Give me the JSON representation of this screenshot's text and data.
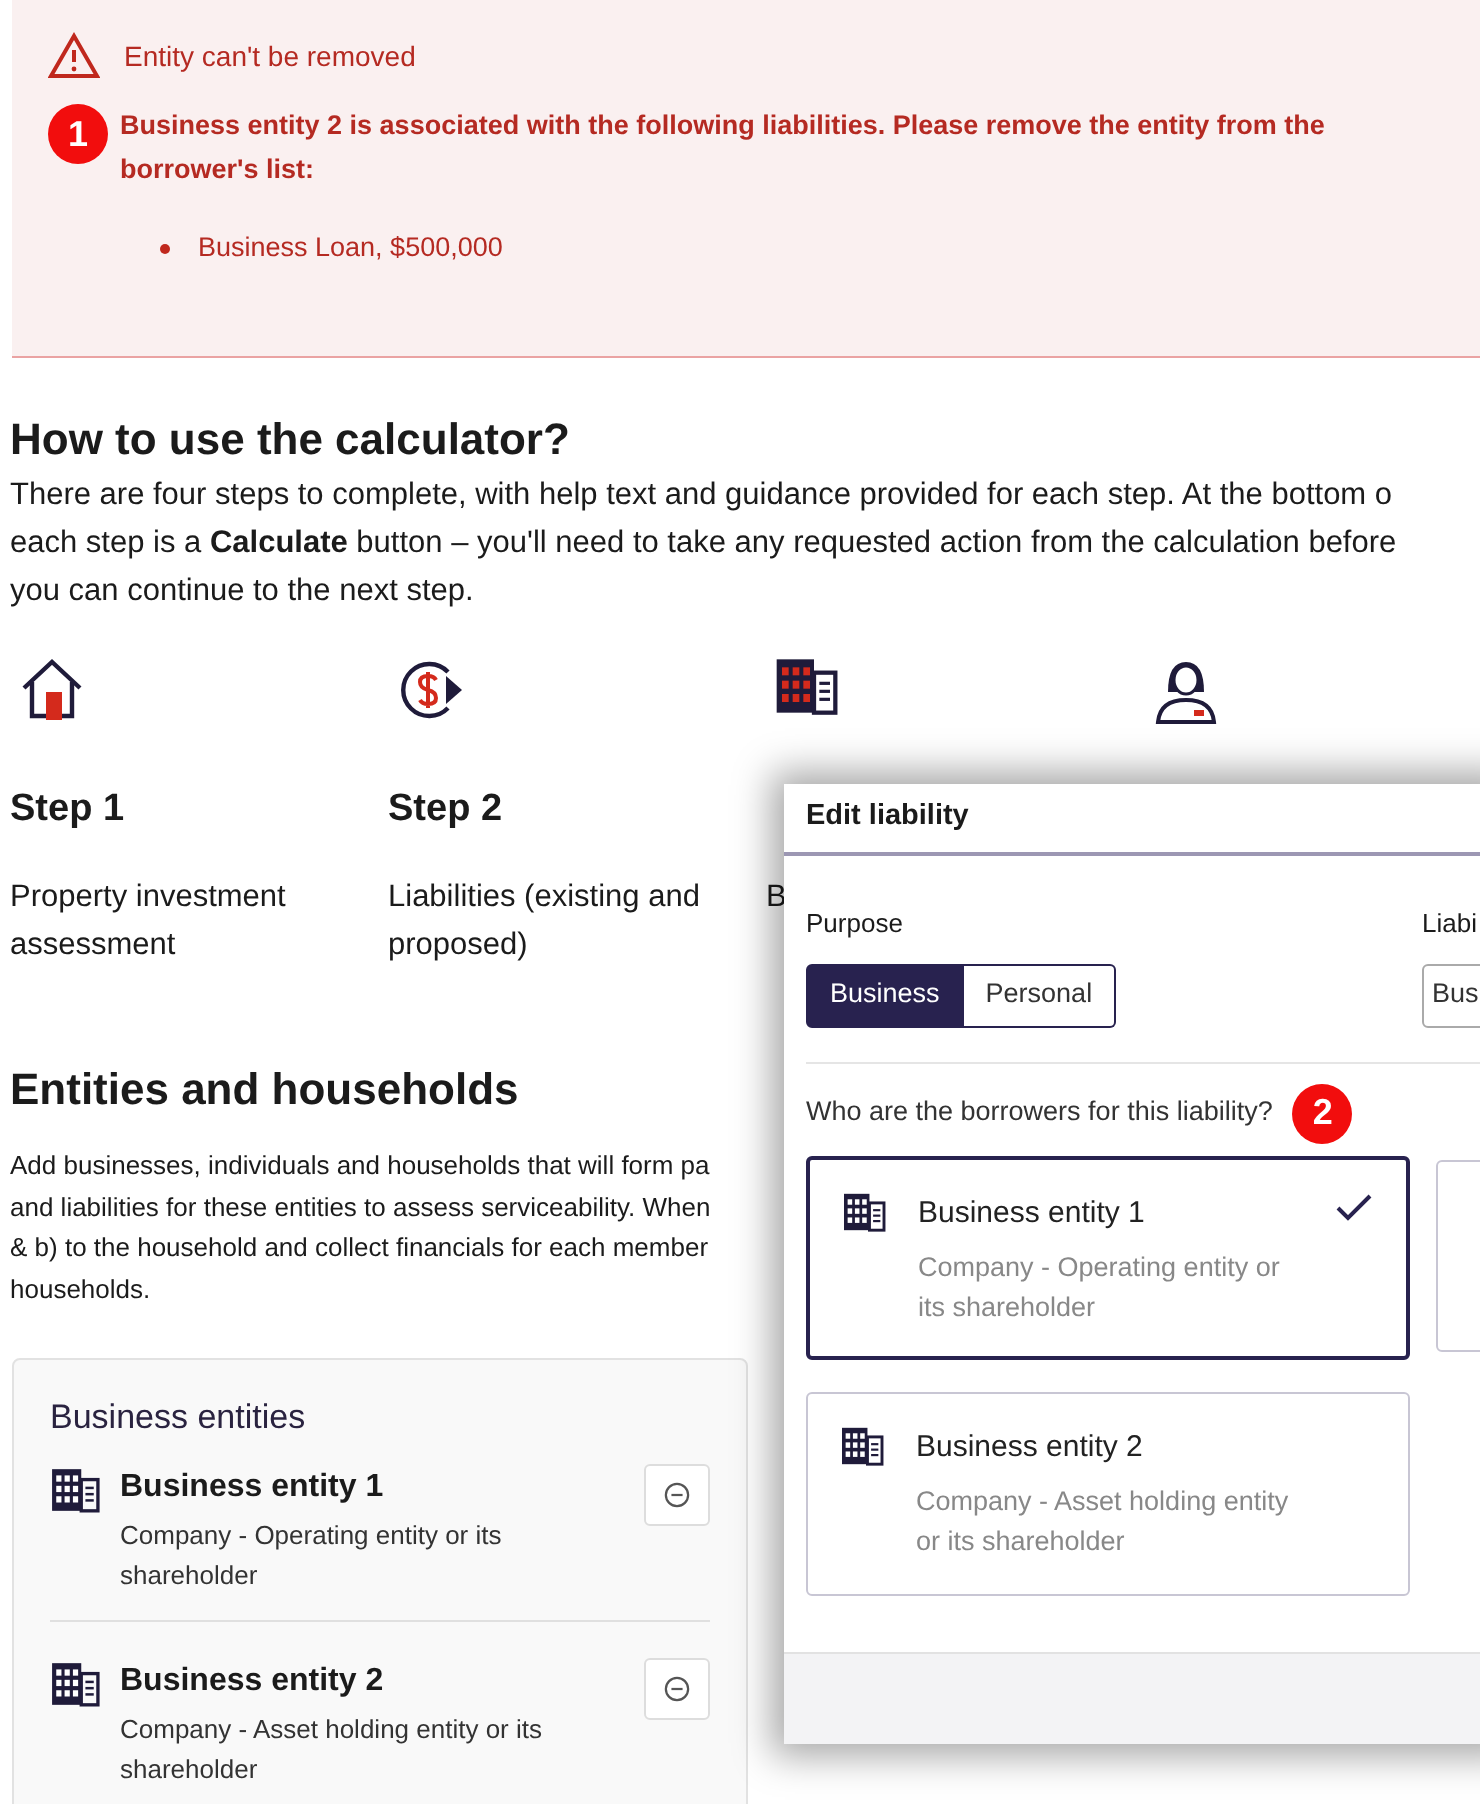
{
  "alert": {
    "title": "Entity can't be removed",
    "marker": "1",
    "message": "Business entity 2 is associated with the following liabilities. Please remove the entity from the borrower's list:",
    "items": [
      "Business Loan, $500,000"
    ]
  },
  "guide": {
    "heading": "How to use the calculator?",
    "lines": [
      "There are four steps to complete, with help text and guidance provided for each step. At the bottom o",
      "each step is a **Calculate** button – you'll need to take any requested action from the calculation before",
      "you can continue to the next step."
    ],
    "steps": [
      {
        "kind": "house",
        "title": "Step 1",
        "description": "Property investment assessment"
      },
      {
        "kind": "money",
        "title": "Step 2",
        "description": "Liabilities (existing and proposed)"
      },
      {
        "kind": "building",
        "description": "B"
      },
      {
        "kind": "person"
      }
    ]
  },
  "entities": {
    "heading": "Entities and households",
    "lines": [
      "Add businesses, individuals and households that will form pa",
      "and liabilities for these entities to assess serviceability. When",
      "& b) to the household and collect financials for each member",
      "households."
    ],
    "card": {
      "title": "Business entities",
      "items": [
        {
          "name": "Business entity 1",
          "description": "Company - Operating entity or its shareholder"
        },
        {
          "name": "Business entity 2",
          "description": "Company - Asset holding entity or its shareholder"
        }
      ]
    }
  },
  "dialog": {
    "title": "Edit liability",
    "purpose": {
      "label": "Purpose",
      "options": [
        {
          "label": "Business",
          "selected": true
        },
        {
          "label": "Personal",
          "selected": false
        }
      ]
    },
    "liability_type": {
      "label": "Liabi",
      "value": "Bus"
    },
    "borrowers": {
      "question": "Who are the borrowers for this liability?",
      "marker": "2",
      "options": [
        {
          "name": "Business entity 1",
          "description": "Company - Operating entity or its shareholder",
          "selected": true
        },
        {
          "name": "Business entity 2",
          "description": "Company - Asset holding entity or its shareholder",
          "selected": false
        }
      ]
    }
  }
}
